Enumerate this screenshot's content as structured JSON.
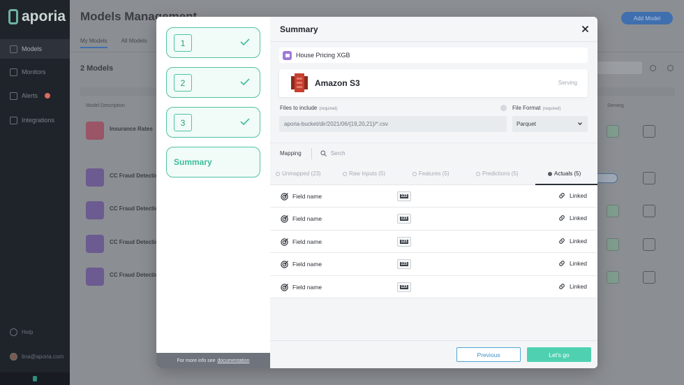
{
  "background": {
    "logo": "aporia",
    "sidebar": [
      {
        "label": "Models",
        "active": true
      },
      {
        "label": "Monitors",
        "active": false
      },
      {
        "label": "Alerts",
        "active": false,
        "badge": true
      },
      {
        "label": "Integrations",
        "active": false
      }
    ],
    "help": "Help",
    "user": "lina@aporia.com",
    "title": "Models Management",
    "add_button": "Add Model",
    "tabs": [
      "My Models",
      "All Models"
    ],
    "count": "2 Models",
    "column_header": "Model Description",
    "column_header_2": "Serving",
    "rows": [
      "Insurance Rates",
      "CC Fraud Detection",
      "CC Fraud Detection",
      "CC Fraud Detection",
      "CC Fraud Detection"
    ]
  },
  "modal": {
    "steps": [
      {
        "number": "1",
        "completed": true
      },
      {
        "number": "2",
        "completed": true
      },
      {
        "number": "3",
        "completed": true
      },
      {
        "label": "Summary",
        "active": true
      }
    ],
    "info_text": "For more info see",
    "info_link": "documentation",
    "header_title": "Summary",
    "model_name": "House Pricing XGB",
    "source_name": "Amazon S3",
    "source_status": "Serving",
    "files_label": "Files to include",
    "files_required": "(required)",
    "files_value": "aporia-bucket/dir/2021/06/{19,20,21}/*.csv",
    "format_label": "File Format",
    "format_required": "(required)",
    "format_value": "Parquet",
    "mapping_label": "Mapping",
    "search_placeholder": "Serch",
    "tabs": [
      {
        "label": "Unmapped (23)",
        "active": false
      },
      {
        "label": "Raw Inputs (5)",
        "active": false
      },
      {
        "label": "Features (5)",
        "active": false
      },
      {
        "label": "Predictions (5)",
        "active": false
      },
      {
        "label": "Actuals (5)",
        "active": true
      }
    ],
    "fields": [
      {
        "name": "Field name",
        "type": "123",
        "status": "Linked"
      },
      {
        "name": "Field name",
        "type": "123",
        "status": "Linked"
      },
      {
        "name": "Field name",
        "type": "123",
        "status": "Linked"
      },
      {
        "name": "Field name",
        "type": "123",
        "status": "Linked"
      },
      {
        "name": "Field name",
        "type": "123",
        "status": "Linked"
      }
    ],
    "previous_button": "Previous",
    "go_button": "Let's go"
  },
  "colors": {
    "accent": "#4fd1b1",
    "step_border": "#4fc3a3",
    "link_blue": "#3a8fc4",
    "model_icon": "#9f7ad9",
    "s3_icon": "#c7402f"
  }
}
